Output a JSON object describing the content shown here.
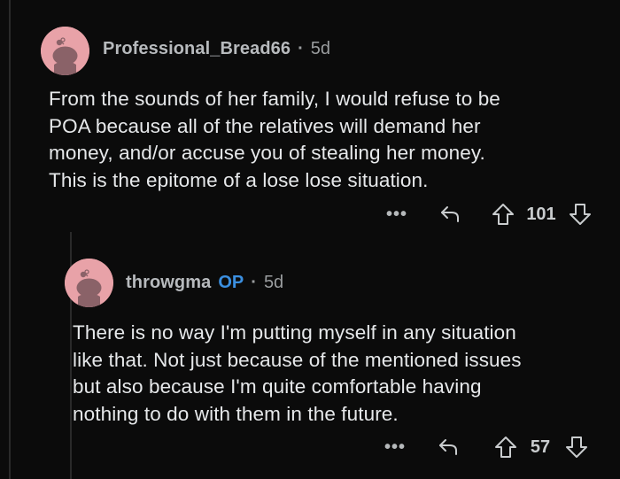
{
  "comments": [
    {
      "username": "Professional_Bread66",
      "separator": "·",
      "age": "5d",
      "op_badge": "",
      "body_lines": [
        "From the sounds of her family, I would refuse to be",
        "POA because all of the relatives will demand her",
        "money, and/or accuse you of stealing her money.",
        "This is the epitome of a lose lose situation."
      ],
      "more_label": "•••",
      "score": "101",
      "icons": [
        "snoo-avatar-icon",
        "reply-icon",
        "upvote-icon",
        "downvote-icon"
      ]
    },
    {
      "username": "throwgma",
      "op_badge": "OP",
      "separator": "·",
      "age": "5d",
      "body_lines": [
        "There is no way I'm putting myself in any situation",
        "like that. Not just because of the mentioned issues",
        "but also because I'm quite comfortable having",
        "nothing to do with them in the future."
      ],
      "more_label": "•••",
      "score": "57",
      "icons": [
        "snoo-avatar-icon",
        "reply-icon",
        "upvote-icon",
        "downvote-icon"
      ]
    }
  ],
  "colors": {
    "background": "#0b0b0b",
    "avatar_bg": "#e8a2a8",
    "op_badge": "#3b8fe0",
    "text": "#e6e8ea",
    "meta": "#9a9d9f"
  }
}
